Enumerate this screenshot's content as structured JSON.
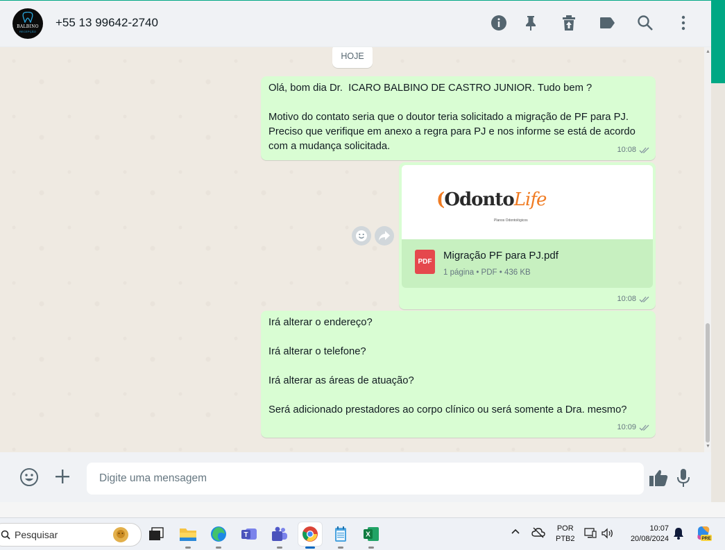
{
  "header": {
    "avatar_text": "BALBINO",
    "avatar_subtext": "RECEPÇÃO",
    "contact_name": "+55 13 99642-2740",
    "icons": [
      "info-icon",
      "pin-icon",
      "delete-icon",
      "label-icon",
      "search-icon",
      "menu-icon"
    ]
  },
  "chat": {
    "date_chip": "HOJE",
    "messages": [
      {
        "text": "Olá, bom dia Dr.  ICARO BALBINO DE CASTRO JUNIOR. Tudo bem ?\n\nMotivo do contato seria que o doutor teria solicitado a migração de PF para PJ.\nPreciso que verifique em anexo a regra para PJ e nos informe se está de acordo\ncom a mudança solicitada.",
        "time": "10:08"
      },
      {
        "document": {
          "logo_main": "Odonto",
          "logo_accent": "Life",
          "logo_sub": "Planos Odontológicos",
          "icon_label": "PDF",
          "name": "Migração PF para PJ.pdf",
          "meta": "1 página • PDF • 436 KB"
        },
        "time": "10:08"
      },
      {
        "text": "Irá alterar o endereço?\n\nIrá alterar o telefone?\n\nIrá alterar as áreas de atuação?\n\nSerá adicionado prestadores ao corpo clínico ou será somente a Dra. mesmo?",
        "time": "10:09"
      }
    ]
  },
  "composer": {
    "placeholder": "Digite uma mensagem"
  },
  "taskbar": {
    "search_label": "Pesquisar",
    "language_line1": "POR",
    "language_line2": "PTB2",
    "time": "10:07",
    "date": "20/08/2024",
    "copilot_badge": "PRE"
  },
  "colors": {
    "accent": "#00a884",
    "outgoing_bubble": "#d9fdd3",
    "chat_background": "#efeae2",
    "header_background": "#f0f2f5"
  }
}
